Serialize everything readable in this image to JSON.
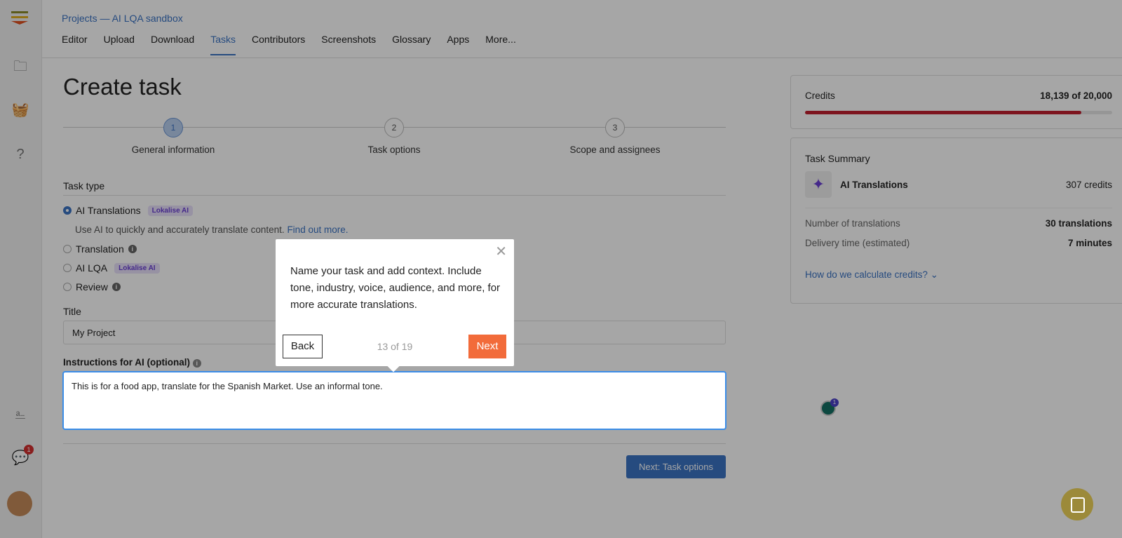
{
  "breadcrumb": "Projects — AI LQA sandbox",
  "tabs": [
    "Editor",
    "Upload",
    "Download",
    "Tasks",
    "Contributors",
    "Screenshots",
    "Glossary",
    "Apps",
    "More..."
  ],
  "active_tab": "Tasks",
  "title": "Create task",
  "steps": [
    {
      "num": "1",
      "label": "General information"
    },
    {
      "num": "2",
      "label": "Task options"
    },
    {
      "num": "3",
      "label": "Scope and assignees"
    }
  ],
  "form": {
    "task_type_label": "Task type",
    "options": [
      {
        "label": "AI Translations",
        "badge": "Lokalise AI",
        "selected": true
      },
      {
        "label": "Translation",
        "info": "i"
      },
      {
        "label": "AI LQA",
        "badge": "Lokalise AI"
      },
      {
        "label": "Review",
        "info": "i"
      }
    ],
    "ai_desc": "Use AI to quickly and accurately translate content.",
    "find_out_more": "Find out more.",
    "title_label": "Title",
    "title_value": "My Project",
    "instructions_label": "Instructions for AI (optional)",
    "instructions_value": "This is for a food app, translate for the Spanish Market.  Use an informal tone.",
    "next_button": "Next: Task options"
  },
  "credits": {
    "label": "Credits",
    "value": "18,139 of 20,000",
    "used_fraction": 0.9,
    "bar_color": "#c0202e"
  },
  "summary": {
    "title": "Task Summary",
    "item": "AI Translations",
    "item_credits": "307 credits",
    "rows": [
      {
        "label": "Number of translations",
        "value": "30 translations"
      },
      {
        "label": "Delivery time (estimated)",
        "value": "7 minutes"
      }
    ],
    "link": "How do we calculate credits? ⌄"
  },
  "tour": {
    "text": "Name your task and add context. Include tone, industry, voice, audience, and more, for more accurate translations.",
    "back": "Back",
    "count": "13 of 19",
    "next": "Next",
    "accent": "#f26b3a"
  },
  "sidebar": {
    "messages_badge": "1"
  },
  "widget_badge": "1"
}
